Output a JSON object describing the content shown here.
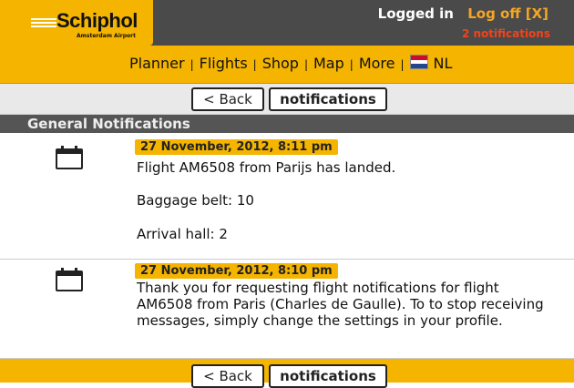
{
  "header": {
    "logo_text": "Schiphol",
    "logo_subtitle": "Amsterdam Airport",
    "logged_in": "Logged in",
    "log_off": "Log off",
    "close_marker": "[X]",
    "notification_count": "2 notifications"
  },
  "nav": {
    "items": [
      {
        "label": "Planner"
      },
      {
        "label": "Flights"
      },
      {
        "label": "Shop"
      },
      {
        "label": "Map"
      },
      {
        "label": "More"
      }
    ],
    "language": "NL",
    "separator": "|"
  },
  "buttons": {
    "back": "< Back",
    "notifications": "notifications"
  },
  "section": {
    "title": "General Notifications"
  },
  "notifications": [
    {
      "timestamp": "27 November, 2012, 8:11 pm",
      "lines": [
        "Flight AM6508 from Parijs has landed.",
        "Baggage belt: 10",
        "Arrival hall: 2"
      ]
    },
    {
      "timestamp": "27 November, 2012, 8:10 pm",
      "lines": [
        "Thank you for requesting flight notifications for flight AM6508 from Paris (Charles de Gaulle). To to stop receiving messages, simply change the settings in your profile."
      ]
    }
  ],
  "colors": {
    "brand_yellow": "#f4b400",
    "dark_header": "#4a4a4a",
    "section_header": "#555555",
    "alert_orange": "#f0441b"
  }
}
